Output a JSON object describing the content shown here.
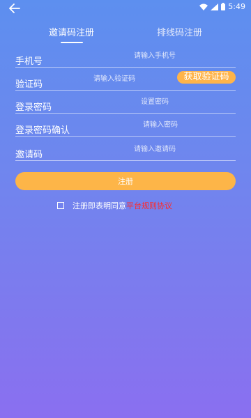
{
  "status_bar": {
    "time": "5:49",
    "wifi_icon": "wifi-icon",
    "signal_icon": "signal-icon",
    "battery_icon": "battery-icon"
  },
  "nav": {
    "back_icon": "arrow-left-icon"
  },
  "tabs": [
    {
      "label": "邀请码注册",
      "active": true
    },
    {
      "label": "排线码注册",
      "active": false
    }
  ],
  "form": {
    "phone": {
      "label": "手机号",
      "placeholder": "请输入手机号"
    },
    "code": {
      "label": "验证码",
      "placeholder": "请输入验证码",
      "button_label": "获取验证码"
    },
    "password": {
      "label": "登录密码",
      "placeholder": "设置密码"
    },
    "password_confirm": {
      "label": "登录密码确认",
      "placeholder": "请输入密码"
    },
    "invite": {
      "label": "邀请码",
      "placeholder": "请输入邀请码"
    }
  },
  "register_button": {
    "label": "注册"
  },
  "agreement": {
    "checkbox_icon": "checkbox-icon",
    "text": "注册即表明同意",
    "link": "平台规则协议"
  },
  "colors": {
    "background_top": "#5d8fef",
    "background_bottom": "#8a6ff0",
    "accent": "#fdb548",
    "link": "#ff2a2a"
  }
}
